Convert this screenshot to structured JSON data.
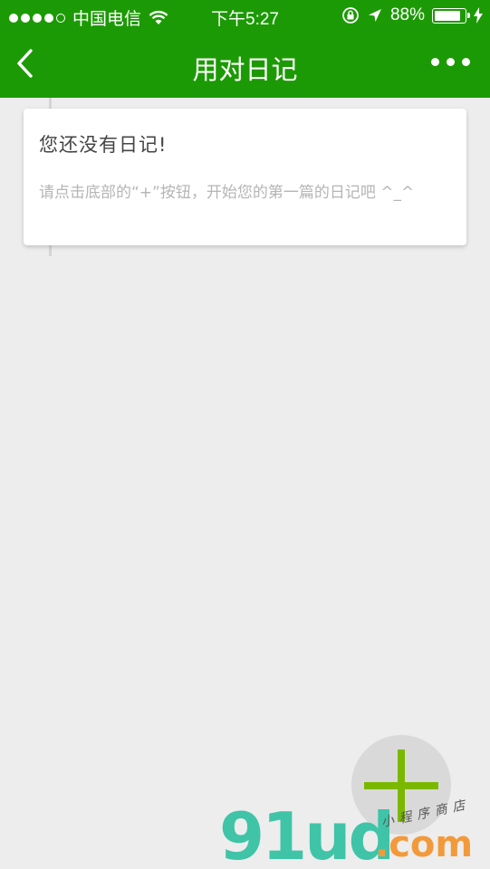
{
  "status_bar": {
    "carrier": "中国电信",
    "time": "下午5:27",
    "battery_percent": "88%",
    "battery_level": 0.88
  },
  "nav": {
    "title": "用对日记",
    "back_icon": "chevron-left-icon",
    "more_icon": "more-dots-icon"
  },
  "empty_card": {
    "title": "您还没有日记!",
    "description": "请点击底部的“+”按钮，开始您的第一篇的日记吧 ^_^"
  },
  "fab": {
    "icon": "plus-icon",
    "color": "#7ab800"
  },
  "watermark": {
    "brand": "91ud",
    "domain": ".com",
    "tagline": "小程序商店"
  },
  "colors": {
    "primary": "#1c9a05",
    "background": "#ededed"
  }
}
